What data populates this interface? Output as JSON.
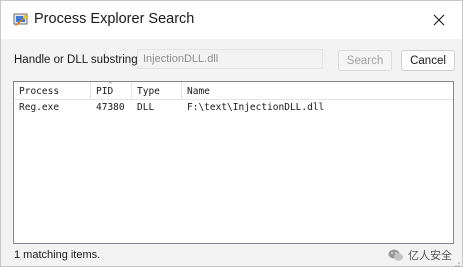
{
  "window": {
    "title": "Process Explorer Search",
    "app_icon": "process-explorer-icon"
  },
  "toolbar": {
    "label": "Handle or DLL substring:",
    "search_value": "InjectionDLL.dll",
    "search_label": "Search",
    "cancel_label": "Cancel"
  },
  "results": {
    "columns": [
      "Process",
      "PID",
      "Type",
      "Name"
    ],
    "sorted_column": "PID",
    "rows": [
      {
        "process": "Reg.exe",
        "pid": "47380",
        "type": "DLL",
        "name": "F:\\text\\InjectionDLL.dll"
      }
    ]
  },
  "status": {
    "text": "1 matching items.",
    "watermark_text": "亿人安全",
    "watermark_icon": "wechat-icon"
  }
}
